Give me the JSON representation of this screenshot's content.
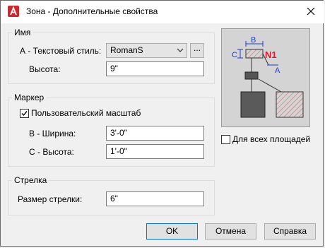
{
  "window": {
    "title": "Зона - Дополнительные свойства",
    "icon": "autocad-icon"
  },
  "groups": {
    "name": {
      "title": "Имя",
      "text_style_label": "А - Текстовый стиль:",
      "text_style_value": "RomanS",
      "browse_label": "...",
      "height_label": "Высота:",
      "height_value": "9\""
    },
    "marker": {
      "title": "Маркер",
      "custom_scale_label": "Пользовательский масштаб",
      "custom_scale_checked": true,
      "width_label": "В - Ширина:",
      "width_value": "3'-0\"",
      "height_label": "С - Высота:",
      "height_value": "1'-0\""
    },
    "arrow": {
      "title": "Стрелка",
      "arrow_size_label": "Размер стрелки:",
      "arrow_size_value": "6\""
    }
  },
  "preview": {
    "dim_b": "B",
    "dim_c": "C",
    "label_n1": "N1",
    "dim_a": "A",
    "colors": {
      "accent": "#1a3cc8",
      "highlight": "#e0182d",
      "hatch": "#d05a5a"
    }
  },
  "all_areas": {
    "label": "Для всех площадей",
    "checked": false
  },
  "buttons": {
    "ok": "OK",
    "cancel": "Отмена",
    "help": "Справка"
  }
}
